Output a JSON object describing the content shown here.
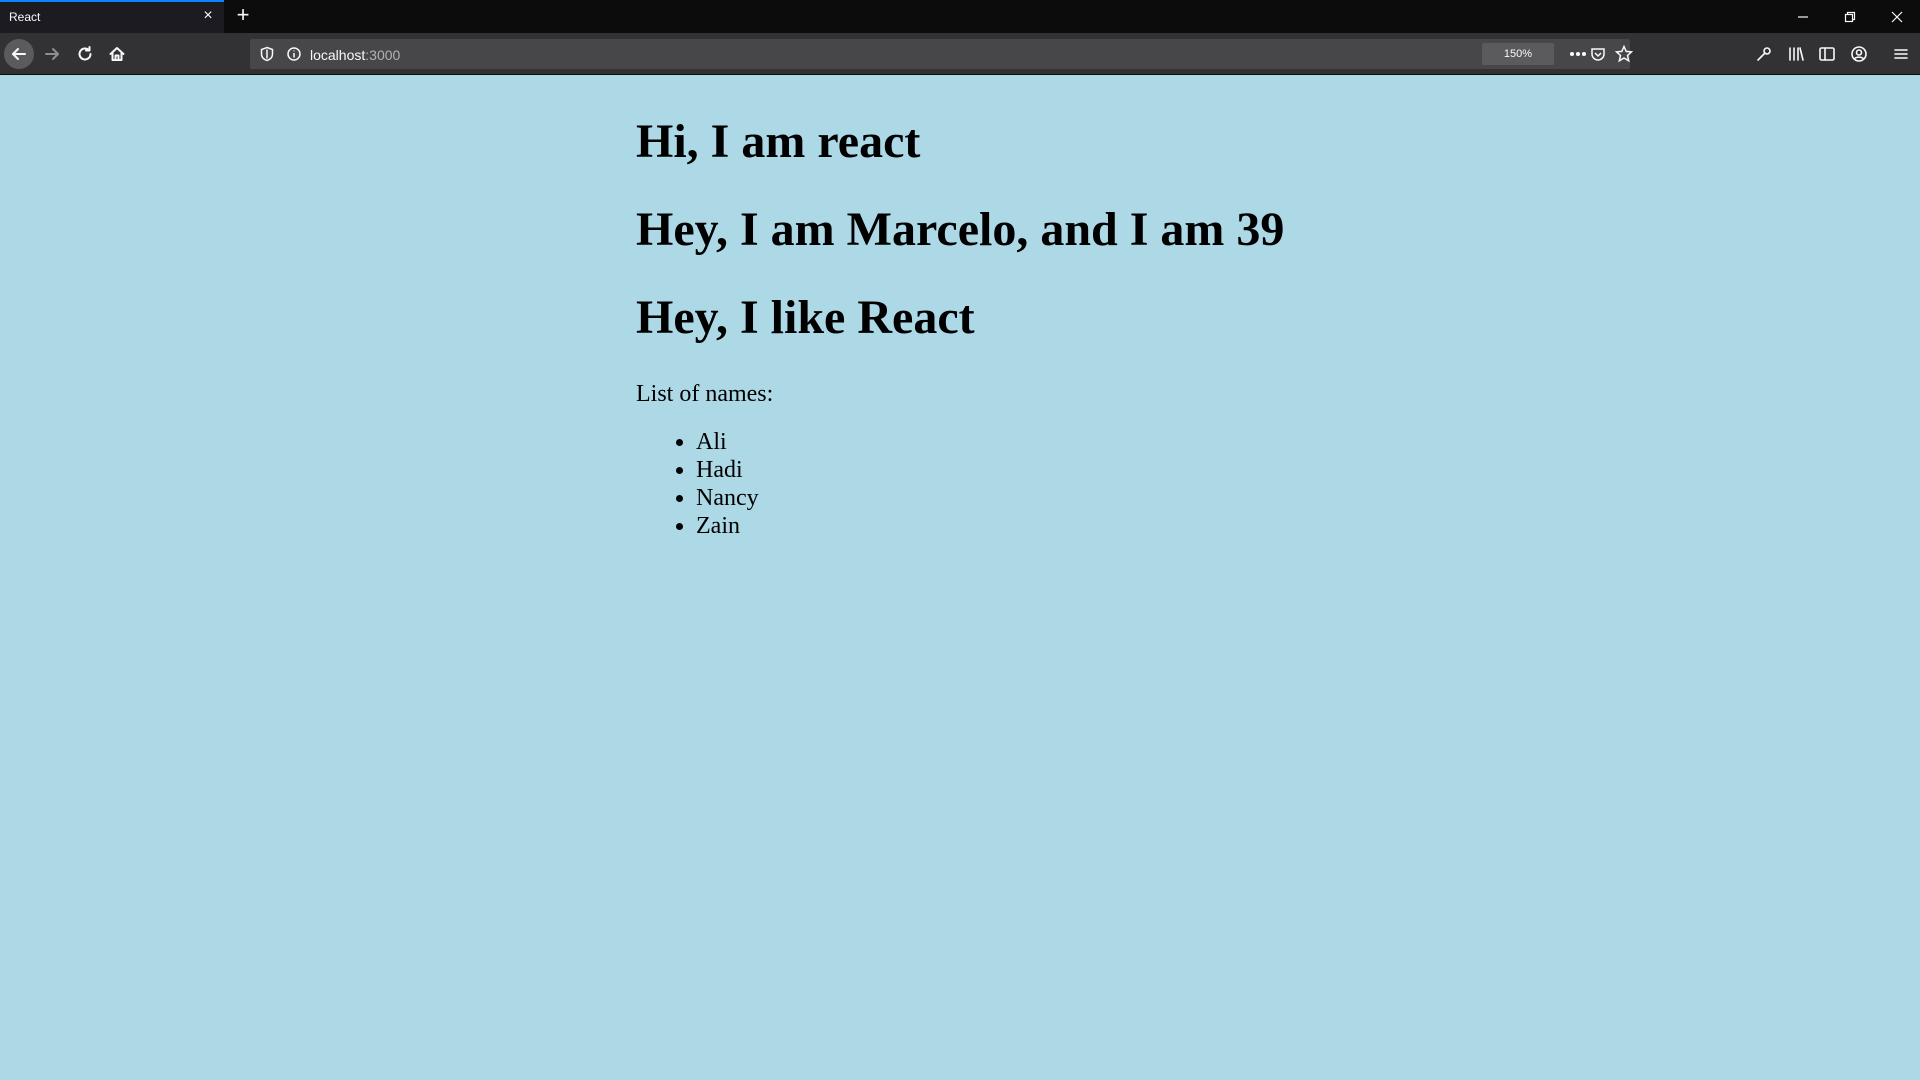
{
  "tab": {
    "title": "React"
  },
  "urlbar": {
    "host": "localhost",
    "port": ":3000",
    "zoom": "150%"
  },
  "page": {
    "heading1": "Hi, I am react",
    "heading2": "Hey, I am Marcelo, and I am 39",
    "heading3": "Hey, I like React",
    "list_label": "List of names:",
    "names": [
      "Ali",
      "Hadi",
      "Nancy",
      "Zain"
    ]
  },
  "colors": {
    "page_background": "#add8e6",
    "tab_accent": "#0a84ff"
  }
}
